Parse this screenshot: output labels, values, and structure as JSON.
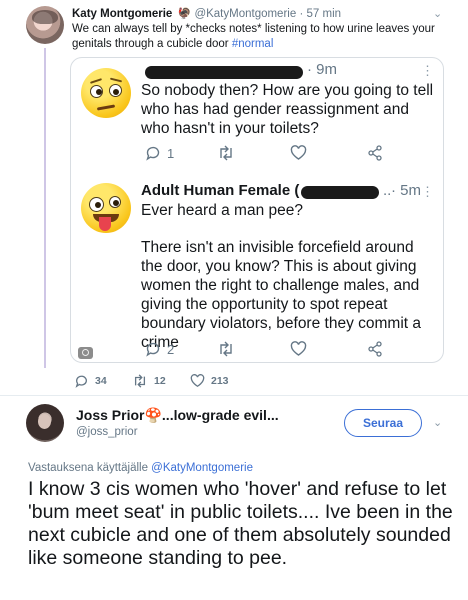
{
  "top_tweet": {
    "name": "Katy Montgomerie",
    "name_emoji": "🦃",
    "handle": "@KatyMontgomerie",
    "separator": "·",
    "time": "57 min",
    "text": "We can always tell by *checks notes* listening to how urine leaves your genitals through a cubicle door ",
    "hashtag": "#normal",
    "replies": "34",
    "retweets": "12",
    "likes": "213"
  },
  "embed": {
    "reply1": {
      "time": "· 9m",
      "text": "So nobody then? How are you going to tell who has had gender reassignment and who hasn't in your toilets?",
      "replies": "1",
      "menu": "⋮"
    },
    "reply2": {
      "name": "Adult Human Female (",
      "ellipsis": "..",
      "time": "· 5m",
      "text1": "Ever heard a man pee?",
      "text2": "There isn't an invisible forcefield around the door, you know? This is about giving women the right to challenge males, and giving the opportunity to spot repeat boundary violators, before they commit a crime",
      "replies": "2",
      "menu": "⋮"
    }
  },
  "joss_tweet": {
    "name": "Joss Prior",
    "name_emoji": "🍄",
    "name_suffix": "...low-grade evil...",
    "handle": "@joss_prior",
    "follow_label": "Seuraa",
    "reply_context": "Vastauksena käyttäjälle ",
    "reply_mention": "@KatyMontgomerie",
    "text": "I know 3 cis women who 'hover' and refuse to let 'bum meet seat' in public toilets.... Ive been in the next cubicle and one of them absolutely sounded like someone standing to pee."
  },
  "icons": {
    "chevron": "⌄"
  },
  "colors": {
    "link": "#3b6fd6",
    "muted": "#657786",
    "thread_line": "#cfc6e6"
  }
}
